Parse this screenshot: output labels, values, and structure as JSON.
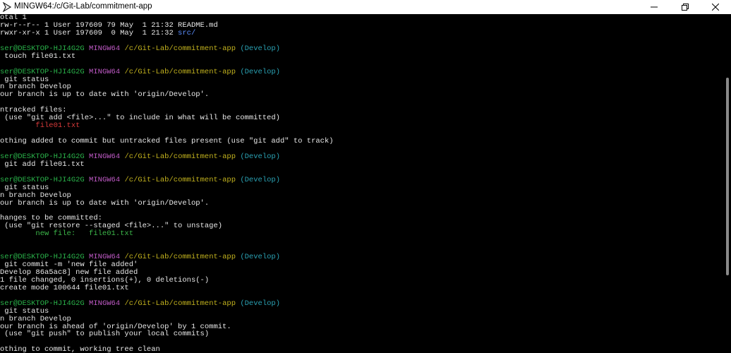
{
  "window": {
    "title": "MINGW64:/c/Git-Lab/commitment-app"
  },
  "colors": {
    "user": "#2ab34a",
    "host": "#c15bc7",
    "path": "#c2b21e",
    "branch": "#2aa1b3",
    "untracked": "#d83a3a",
    "staged": "#3cb84a",
    "directory": "#5c8fff"
  },
  "prompt": {
    "user": "ser@DESKTOP-HJI4G2G",
    "shell": "MINGW64",
    "path": "/c/Git-Lab/commitment-app",
    "branch": "(Develop)"
  },
  "terminal": {
    "l01": "otal 1",
    "l02": "rw-r--r-- 1 User 197609 79 May  1 21:32 README.md",
    "l03a": "rwxr-xr-x 1 User 197609  0 May  1 21:32 ",
    "l03b": "src/",
    "l06": " touch file01.txt",
    "l09": " git status",
    "l10": "n branch Develop",
    "l11": "our branch is up to date with 'origin/Develop'.",
    "l13": "ntracked files:",
    "l14": " (use \"git add <file>...\" to include in what will be committed)",
    "l15": "        file01.txt",
    "l17": "othing added to commit but untracked files present (use \"git add\" to track)",
    "l20": " git add file01.txt",
    "l23": " git status",
    "l24": "n branch Develop",
    "l25": "our branch is up to date with 'origin/Develop'.",
    "l27": "hanges to be committed:",
    "l28": " (use \"git restore --staged <file>...\" to unstage)",
    "l29": "        new file:   file01.txt",
    "l33": " git commit -m 'new file added'",
    "l34": "Develop 86a5ac8] new file added",
    "l35": "1 file changed, 0 insertions(+), 0 deletions(-)",
    "l36": "create mode 100644 file01.txt",
    "l39": " git status",
    "l40": "n branch Develop",
    "l41": "our branch is ahead of 'origin/Develop' by 1 commit.",
    "l42": " (use \"git push\" to publish your local commits)",
    "l44": "othing to commit, working tree clean"
  }
}
